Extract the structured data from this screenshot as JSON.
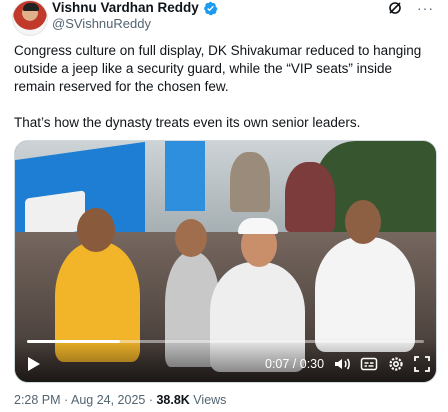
{
  "author": {
    "display_name": "Vishnu Vardhan Reddy",
    "handle": "@SVishnuReddy",
    "verified": true,
    "verified_color": "#1d9bf0"
  },
  "header": {
    "grok_icon": "grok-icon",
    "more_icon": "more-horizontal-icon",
    "more_label": "···"
  },
  "tweet": {
    "paragraphs": [
      "Congress culture on full display, DK Shivakumar reduced to hanging outside a jeep like a security guard, while the “VIP seats” inside remain reserved for the chosen few.",
      "That’s how the dynasty treats even its own senior leaders."
    ]
  },
  "video": {
    "time": "0:07 / 0:30",
    "progress": 0.233,
    "icons": [
      "play-icon",
      "volume-icon",
      "captions-icon",
      "settings-icon",
      "fullscreen-icon"
    ]
  },
  "meta": {
    "time": "2:28 PM",
    "sep1": " · ",
    "date": "Aug 24, 2025",
    "sep2": " · ",
    "views_count": "38.8K",
    "views_label": " Views"
  }
}
